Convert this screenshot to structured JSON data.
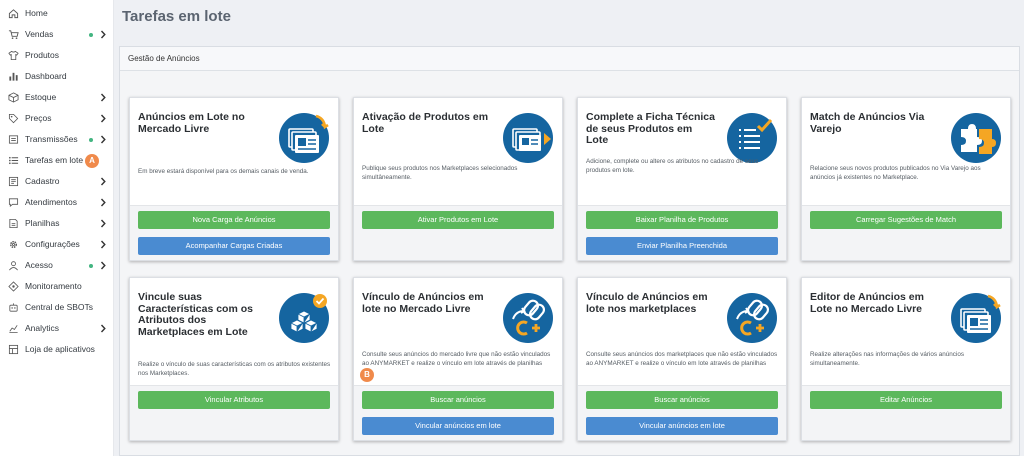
{
  "sidebar": {
    "items": [
      {
        "label": "Home",
        "icon": "home-icon"
      },
      {
        "label": "Vendas",
        "icon": "cart-icon",
        "dot": true,
        "chevron": true
      },
      {
        "label": "Produtos",
        "icon": "shirt-icon"
      },
      {
        "label": "Dashboard",
        "icon": "bar-chart-icon"
      },
      {
        "label": "Estoque",
        "icon": "box-icon",
        "chevron": true
      },
      {
        "label": "Preços",
        "icon": "price-tag-icon",
        "chevron": true
      },
      {
        "label": "Transmissões",
        "icon": "transmission-icon",
        "dot": true,
        "chevron": true
      },
      {
        "label": "Tarefas em lote",
        "icon": "list-icon",
        "marker": "A"
      },
      {
        "label": "Cadastro",
        "icon": "register-icon",
        "chevron": true
      },
      {
        "label": "Atendimentos",
        "icon": "chat-icon",
        "chevron": true
      },
      {
        "label": "Planilhas",
        "icon": "spreadsheet-icon",
        "chevron": true
      },
      {
        "label": "Configurações",
        "icon": "gear-icon",
        "chevron": true
      },
      {
        "label": "Acesso",
        "icon": "user-icon",
        "dot": true,
        "chevron": true
      },
      {
        "label": "Monitoramento",
        "icon": "monitor-icon"
      },
      {
        "label": "Central de SBOTs",
        "icon": "bot-icon"
      },
      {
        "label": "Analytics",
        "icon": "analytics-icon",
        "chevron": true
      },
      {
        "label": "Loja de aplicativos",
        "icon": "store-icon"
      }
    ]
  },
  "header": {
    "title": "Tarefas em lote"
  },
  "panel": {
    "title": "Gestão de Anúncios"
  },
  "cards": [
    {
      "title": "Anúncios em Lote no Mercado Livre",
      "description": "Em breve estará disponível para os demais canais de venda.",
      "icon": "ad-cards-icon",
      "buttons": [
        {
          "label": "Nova Carga de Anúncios",
          "style": "green"
        },
        {
          "label": "Acompanhar Cargas Criadas",
          "style": "blue"
        }
      ]
    },
    {
      "title": "Ativação de Produtos em Lote",
      "description": "Publique seus produtos nos Marketplaces selecionados simultâneamente.",
      "icon": "product-activation-icon",
      "buttons": [
        {
          "label": "Ativar Produtos em Lote",
          "style": "green"
        }
      ]
    },
    {
      "title": "Complete a Ficha Técnica de seus Produtos em Lote",
      "description": "Adicione, complete ou altere os atributos no cadastro de seus produtos em lote.",
      "icon": "checklist-icon",
      "buttons": [
        {
          "label": "Baixar Planilha de Produtos",
          "style": "green"
        },
        {
          "label": "Enviar Planilha Preenchida",
          "style": "blue"
        }
      ]
    },
    {
      "title": "Match de Anúncios Via Varejo",
      "description": "Relacione seus novos produtos publicados no Via Varejo aos anúncios já existentes no Marketplace.",
      "icon": "puzzle-icon",
      "buttons": [
        {
          "label": "Carregar Sugestões de Match",
          "style": "green"
        }
      ]
    },
    {
      "title": "Vincule suas Características com os Atributos dos Marketplaces em Lote",
      "description": "Realize o vínculo de suas características com os atributos existentes nos Marketplaces.",
      "icon": "cubes-icon",
      "buttons": [
        {
          "label": "Vincular Atributos",
          "style": "green"
        }
      ]
    },
    {
      "title": "Vínculo de Anúncios em lote no Mercado Livre",
      "description": "Consulte seus anúncios do mercado livre que não estão vinculados ao ANYMARKET e realize o vínculo em lote através de planilhas",
      "icon": "link-icon",
      "marker": "B",
      "buttons": [
        {
          "label": "Buscar anúncios",
          "style": "green"
        },
        {
          "label": "Vincular anúncios em lote",
          "style": "blue"
        }
      ]
    },
    {
      "title": "Vínculo de Anúncios em lote nos marketplaces",
      "description": "Consulte seus anúncios dos marketplaces que não estão vinculados ao ANYMARKET e realize o vínculo em lote através de planilhas",
      "icon": "link-icon",
      "buttons": [
        {
          "label": "Buscar anúncios",
          "style": "green"
        },
        {
          "label": "Vincular anúncios em lote",
          "style": "blue"
        }
      ]
    },
    {
      "title": "Editor de Anúncios em Lote no Mercado Livre",
      "description": "Realize alterações nas informações de vários anúncios simultaneamente.",
      "icon": "ad-cards-icon",
      "buttons": [
        {
          "label": "Editar Anúncios",
          "style": "green"
        }
      ]
    }
  ],
  "colors": {
    "accent_green": "#5cb85c",
    "accent_blue": "#4a8bd1",
    "icon_blue": "#1565a0",
    "icon_orange": "#f5a623",
    "marker": "#f08a4b"
  }
}
